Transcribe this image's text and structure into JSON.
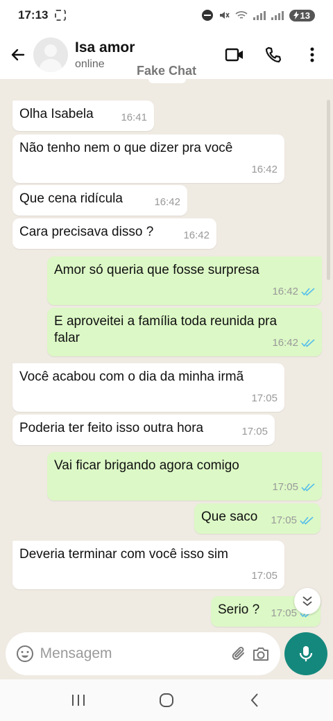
{
  "status_bar": {
    "time": "17:13",
    "battery": "13"
  },
  "header": {
    "contact_name": "Isa amor",
    "contact_status": "online"
  },
  "watermark": "Fake Chat",
  "messages": [
    {
      "dir": "in",
      "text": "Olha Isabela",
      "time": "16:41"
    },
    {
      "dir": "in",
      "text": "Não tenho nem o que dizer pra você",
      "time": "16:42"
    },
    {
      "dir": "in",
      "text": "Que cena ridícula",
      "time": "16:42"
    },
    {
      "dir": "in",
      "text": "Cara precisava disso ?",
      "time": "16:42"
    },
    {
      "dir": "out",
      "text": "Amor só queria que fosse surpresa",
      "time": "16:42",
      "read": true
    },
    {
      "dir": "out",
      "text": "E aproveitei a família toda reunida pra falar",
      "time": "16:42",
      "read": true
    },
    {
      "dir": "in",
      "text": "Você acabou com o dia da minha irmã",
      "time": "17:05"
    },
    {
      "dir": "in",
      "text": "Poderia ter feito isso outra hora",
      "time": "17:05"
    },
    {
      "dir": "out",
      "text": "Vai ficar brigando agora comigo",
      "time": "17:05",
      "read": true
    },
    {
      "dir": "out",
      "text": "Que saco",
      "time": "17:05",
      "read": true
    },
    {
      "dir": "in",
      "text": "Deveria terminar com você isso sim",
      "time": "17:05"
    },
    {
      "dir": "out",
      "text": "Serio ?",
      "time": "17:05",
      "read": true
    }
  ],
  "input": {
    "placeholder": "Mensagem"
  },
  "colors": {
    "accent": "#15887d",
    "outgoing_bubble": "#dcf8c6",
    "incoming_bubble": "#ffffff",
    "read_ticks": "#53bdeb",
    "chat_bg": "#efeae2"
  },
  "icons": [
    "back-arrow-icon",
    "video-call-icon",
    "phone-icon",
    "more-vert-icon",
    "emoji-icon",
    "attach-icon",
    "camera-icon",
    "mic-icon",
    "scroll-down-icon",
    "nav-recents-icon",
    "nav-home-icon",
    "nav-back-icon"
  ]
}
